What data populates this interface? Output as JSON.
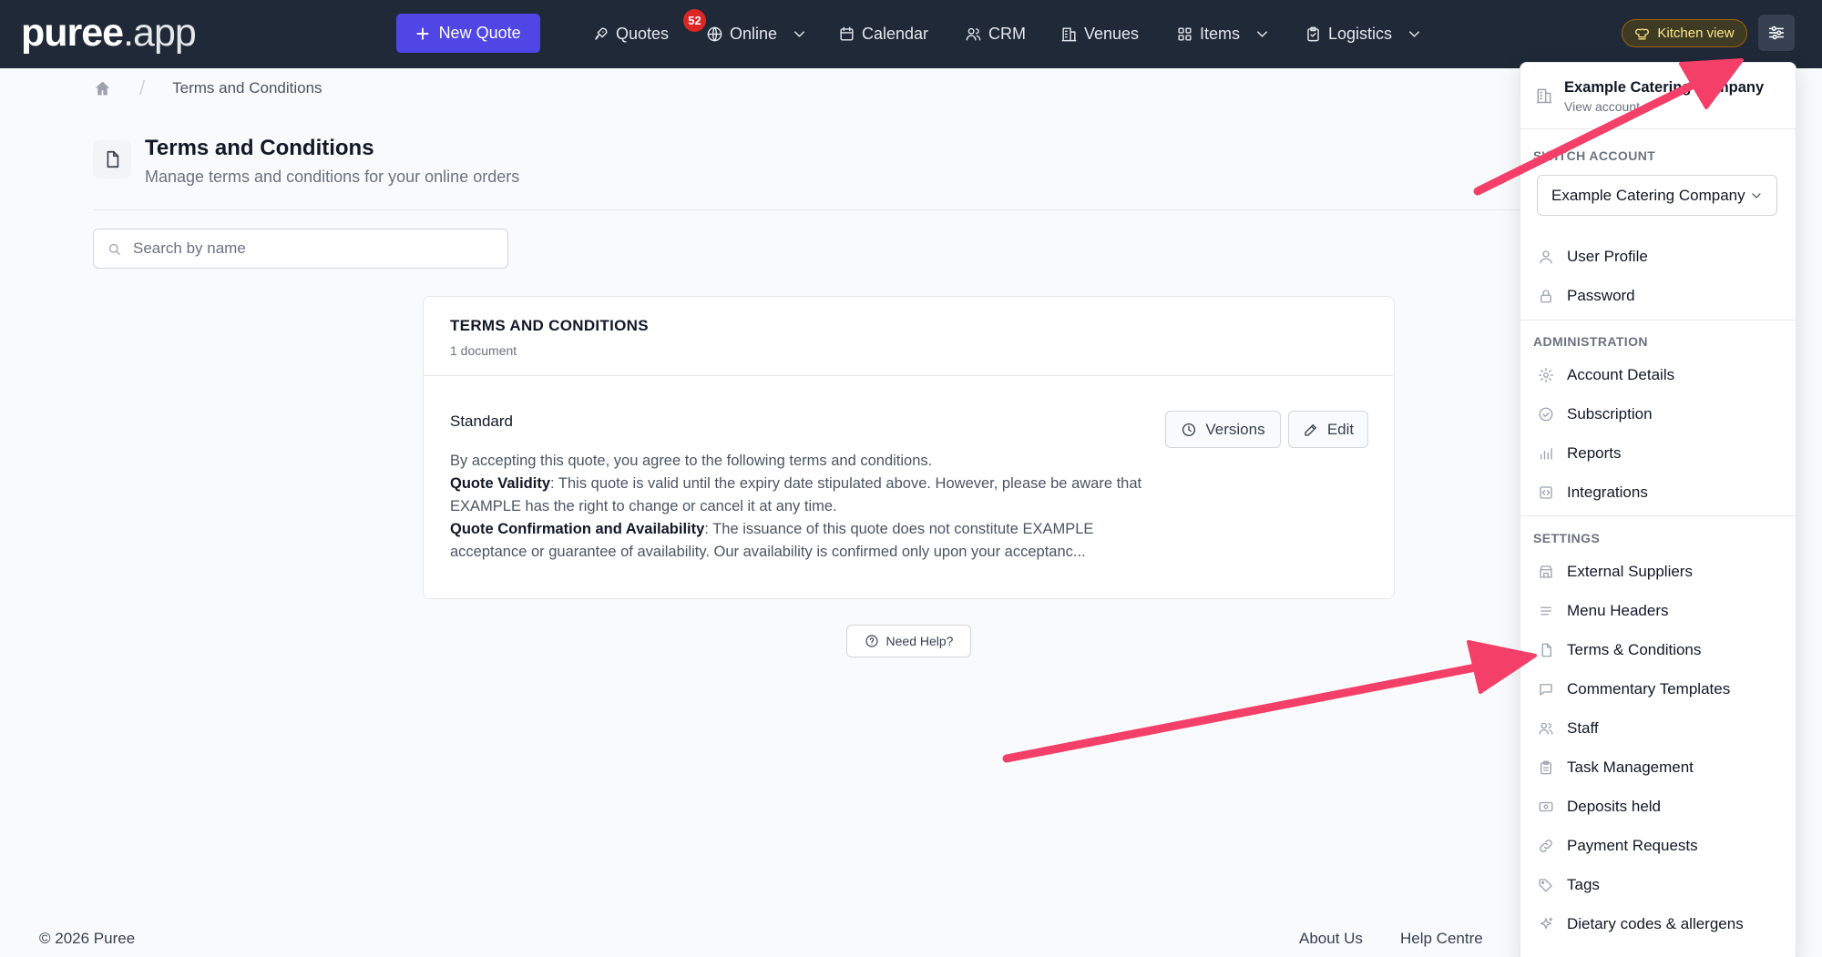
{
  "header": {
    "logo_main": "puree",
    "logo_dot": ".app",
    "new_quote_label": "New Quote",
    "nav": [
      {
        "label": "Quotes",
        "icon": "rocket-icon"
      },
      {
        "label": "Online",
        "icon": "globe-icon"
      },
      {
        "label": "Calendar",
        "icon": "calendar-icon"
      },
      {
        "label": "CRM",
        "icon": "users-icon"
      },
      {
        "label": "Venues",
        "icon": "building-icon"
      },
      {
        "label": "Items",
        "icon": "grid-icon"
      },
      {
        "label": "Logistics",
        "icon": "clipboard-icon"
      }
    ],
    "quotes_badge": "52",
    "kitchen_view_label": "Kitchen view"
  },
  "breadcrumb": {
    "current": "Terms and Conditions"
  },
  "page": {
    "title": "Terms and Conditions",
    "subtitle": "Manage terms and conditions for your online orders"
  },
  "search": {
    "placeholder": "Search by name",
    "value": ""
  },
  "card": {
    "title": "TERMS AND CONDITIONS",
    "count": "1 document",
    "document": {
      "name": "Standard",
      "versions_label": "Versions",
      "edit_label": "Edit",
      "line1": "By accepting this quote, you agree to the following terms and conditions.",
      "heading1": "Quote Validity",
      "text1": ": This quote is valid until the expiry date stipulated above. However, please be aware that EXAMPLE has the right to change or cancel it at any time.",
      "heading2": "Quote Confirmation and Availability",
      "text2": ": The issuance of this quote does not constitute EXAMPLE acceptance or guarantee of availability. Our availability is confirmed only upon your acceptanc..."
    }
  },
  "help_label": "Need Help?",
  "footer": {
    "copyright": "© 2026 Puree",
    "about": "About Us",
    "help_centre": "Help Centre"
  },
  "menu": {
    "account_name": "Example Catering Company",
    "account_sub": "View account",
    "switch_heading": "SWITCH ACCOUNT",
    "switch_value": "Example Catering Company",
    "user_items": [
      {
        "label": "User Profile",
        "icon": "user-icon"
      },
      {
        "label": "Password",
        "icon": "lock-icon"
      }
    ],
    "admin_heading": "ADMINISTRATION",
    "admin_items": [
      {
        "label": "Account Details",
        "icon": "gear-icon"
      },
      {
        "label": "Subscription",
        "icon": "check-circle-icon"
      },
      {
        "label": "Reports",
        "icon": "bar-chart-icon"
      },
      {
        "label": "Integrations",
        "icon": "code-icon"
      }
    ],
    "settings_heading": "SETTINGS",
    "settings_items": [
      {
        "label": "External Suppliers",
        "icon": "store-icon"
      },
      {
        "label": "Menu Headers",
        "icon": "lines-icon"
      },
      {
        "label": "Terms & Conditions",
        "icon": "document-icon"
      },
      {
        "label": "Commentary Templates",
        "icon": "chat-icon"
      },
      {
        "label": "Staff",
        "icon": "users-icon"
      },
      {
        "label": "Task Management",
        "icon": "clipboard-icon"
      },
      {
        "label": "Deposits held",
        "icon": "cash-icon"
      },
      {
        "label": "Payment Requests",
        "icon": "link-icon"
      },
      {
        "label": "Tags",
        "icon": "tag-icon"
      },
      {
        "label": "Dietary codes & allergens",
        "icon": "sparkle-icon"
      }
    ]
  },
  "colors": {
    "accent": "#4f46e5",
    "annotation_arrow": "#f43f68",
    "header_bg": "#1f2937"
  }
}
